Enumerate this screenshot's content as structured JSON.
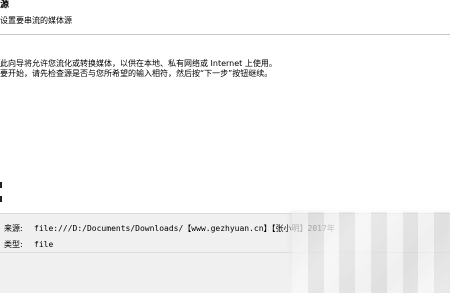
{
  "header": {
    "title": "源",
    "subtitle": "设置要串流的媒体源"
  },
  "description": {
    "line1": "此向导将允许您流化或转换媒体，以供在本地、私有网络或 Internet 上使用。",
    "line2": "要开始，请先检查源是否与您所希望的输入相符，然后按“下一步”按钮继续。"
  },
  "info": {
    "source_label": "来源:",
    "source_value": "file:///D:/Documents/Downloads/【www.gezhyuan.cn】【张小明】2017年",
    "type_label": "类型:",
    "type_value": "file"
  }
}
